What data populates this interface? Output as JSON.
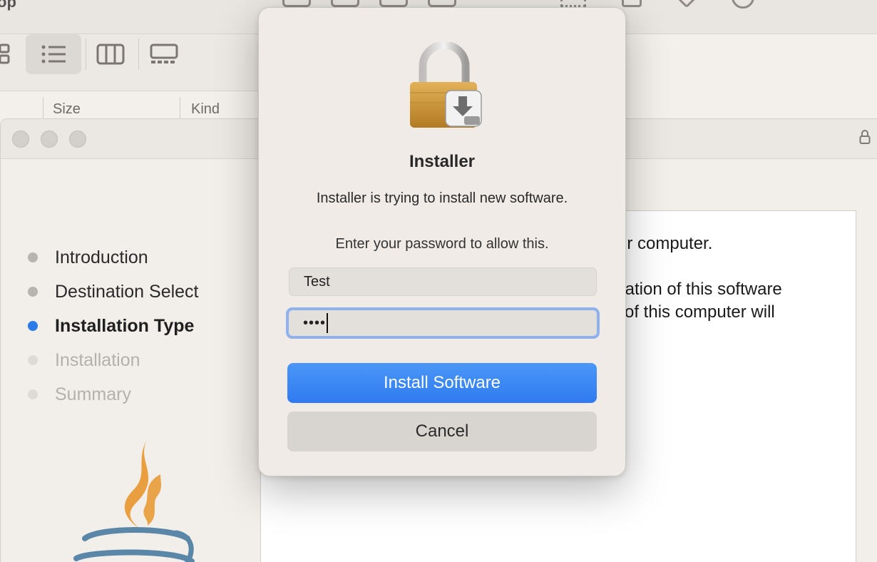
{
  "finder": {
    "title_fragment": "op",
    "columns": [
      "Size",
      "Kind"
    ]
  },
  "installer": {
    "steps": [
      {
        "label": "Introduction",
        "state": "done"
      },
      {
        "label": "Destination Select",
        "state": "done"
      },
      {
        "label": "Installation Type",
        "state": "active"
      },
      {
        "label": "Installation",
        "state": "todo"
      },
      {
        "label": "Summary",
        "state": "todo"
      }
    ],
    "content_lines": [
      "ur computer.",
      "llation of this software",
      "of this computer will"
    ]
  },
  "dialog": {
    "app_name": "Installer",
    "message": "Installer is trying to install new software.",
    "prompt": "Enter your password to allow this.",
    "username_value": "Test",
    "password_masked": "••••",
    "primary_button": "Install Software",
    "secondary_button": "Cancel",
    "primary_color": "#3a86f4"
  }
}
